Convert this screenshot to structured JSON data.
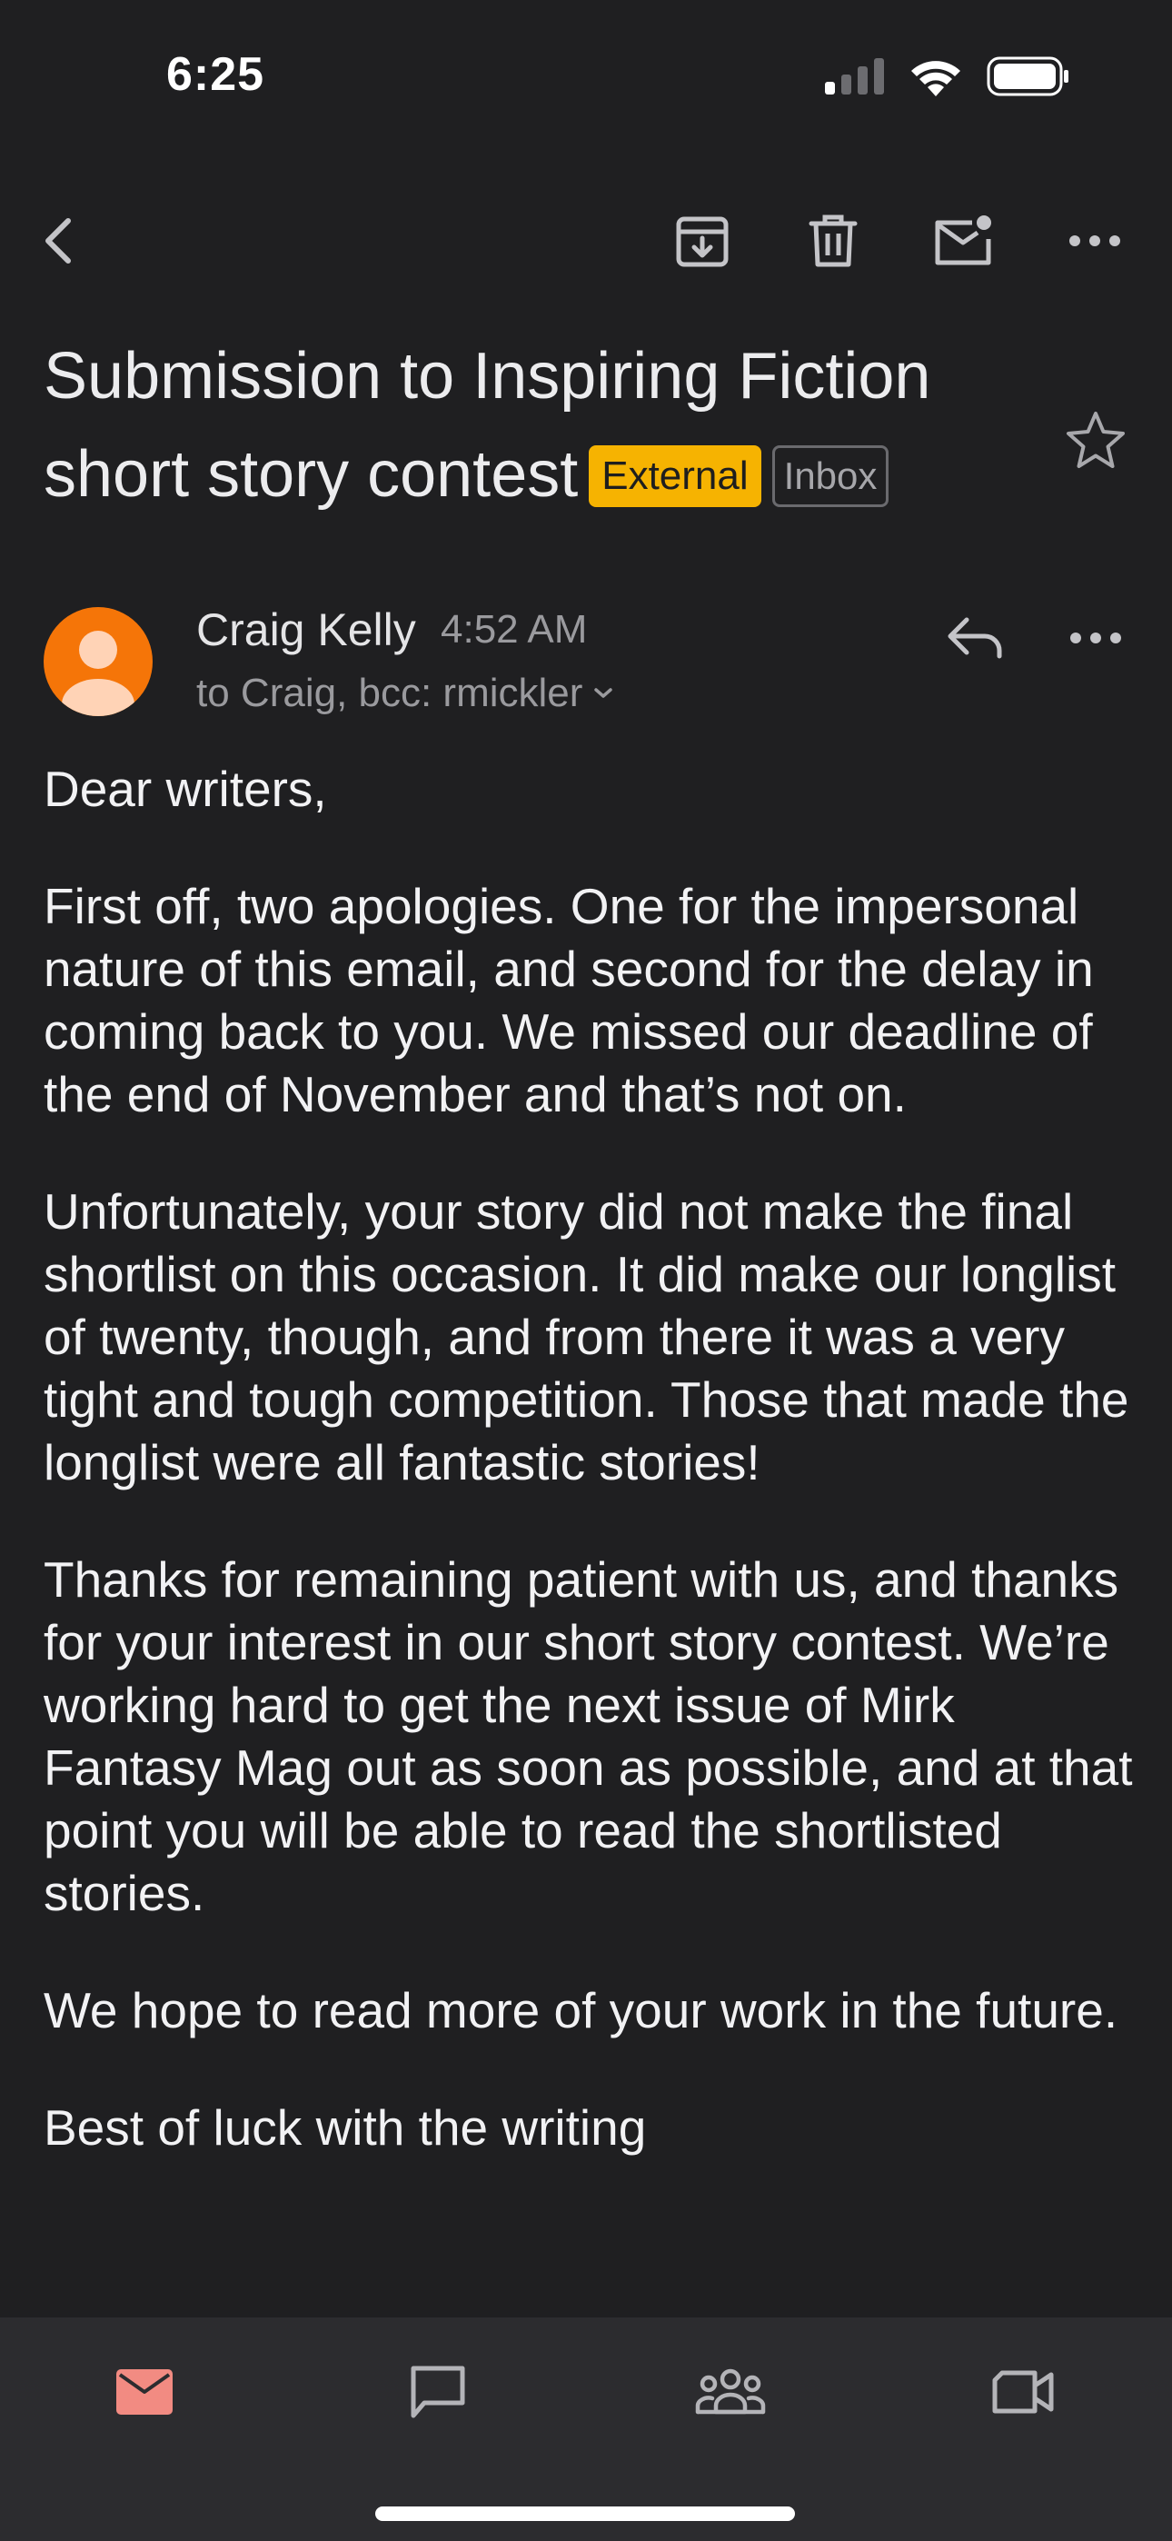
{
  "status_bar": {
    "time": "6:25"
  },
  "toolbar": {
    "back_icon": "chevron-left-icon",
    "archive_icon": "archive-icon",
    "delete_icon": "trash-icon",
    "mark_unread_icon": "mail-unread-icon",
    "more_icon": "more-horizontal-icon"
  },
  "email": {
    "subject": "Submission to Inspiring Fiction short story contest",
    "labels": {
      "external": "External",
      "inbox": "Inbox"
    },
    "sender": {
      "name": "Craig Kelly",
      "time": "4:52 AM",
      "recipients": "to Craig, bcc: rmickler"
    },
    "body": {
      "greeting": "Dear writers,",
      "paragraphs": [
        "First off, two apologies. One for the impersonal nature of this email, and second for the delay in coming back to you. We missed our deadline of the end of November and that’s not on.",
        "Unfortunately, your story did not make the final shortlist on this occasion. It did make our longlist of twenty, though, and from there it was a very tight and tough competition. Those that made the longlist were all fantastic stories!",
        "Thanks for remaining patient with us, and thanks for your interest in our short story contest. We’re working hard to get the next issue of Mirk Fantasy Mag out as soon as possible, and at that point you will be able to read the shortlisted stories.",
        "We hope to read more of your work in the future."
      ],
      "closing": "Best of luck with the writing"
    }
  },
  "bottom_nav": {
    "items": [
      {
        "icon": "mail-icon",
        "active": true
      },
      {
        "icon": "chat-icon",
        "active": false
      },
      {
        "icon": "spaces-icon",
        "active": false
      },
      {
        "icon": "video-icon",
        "active": false
      }
    ]
  },
  "colors": {
    "background": "#1f1f21",
    "external_badge": "#f6b301",
    "avatar": "#f57508",
    "active_nav": "#f28b82",
    "nav_bar": "#2c2c2f"
  }
}
